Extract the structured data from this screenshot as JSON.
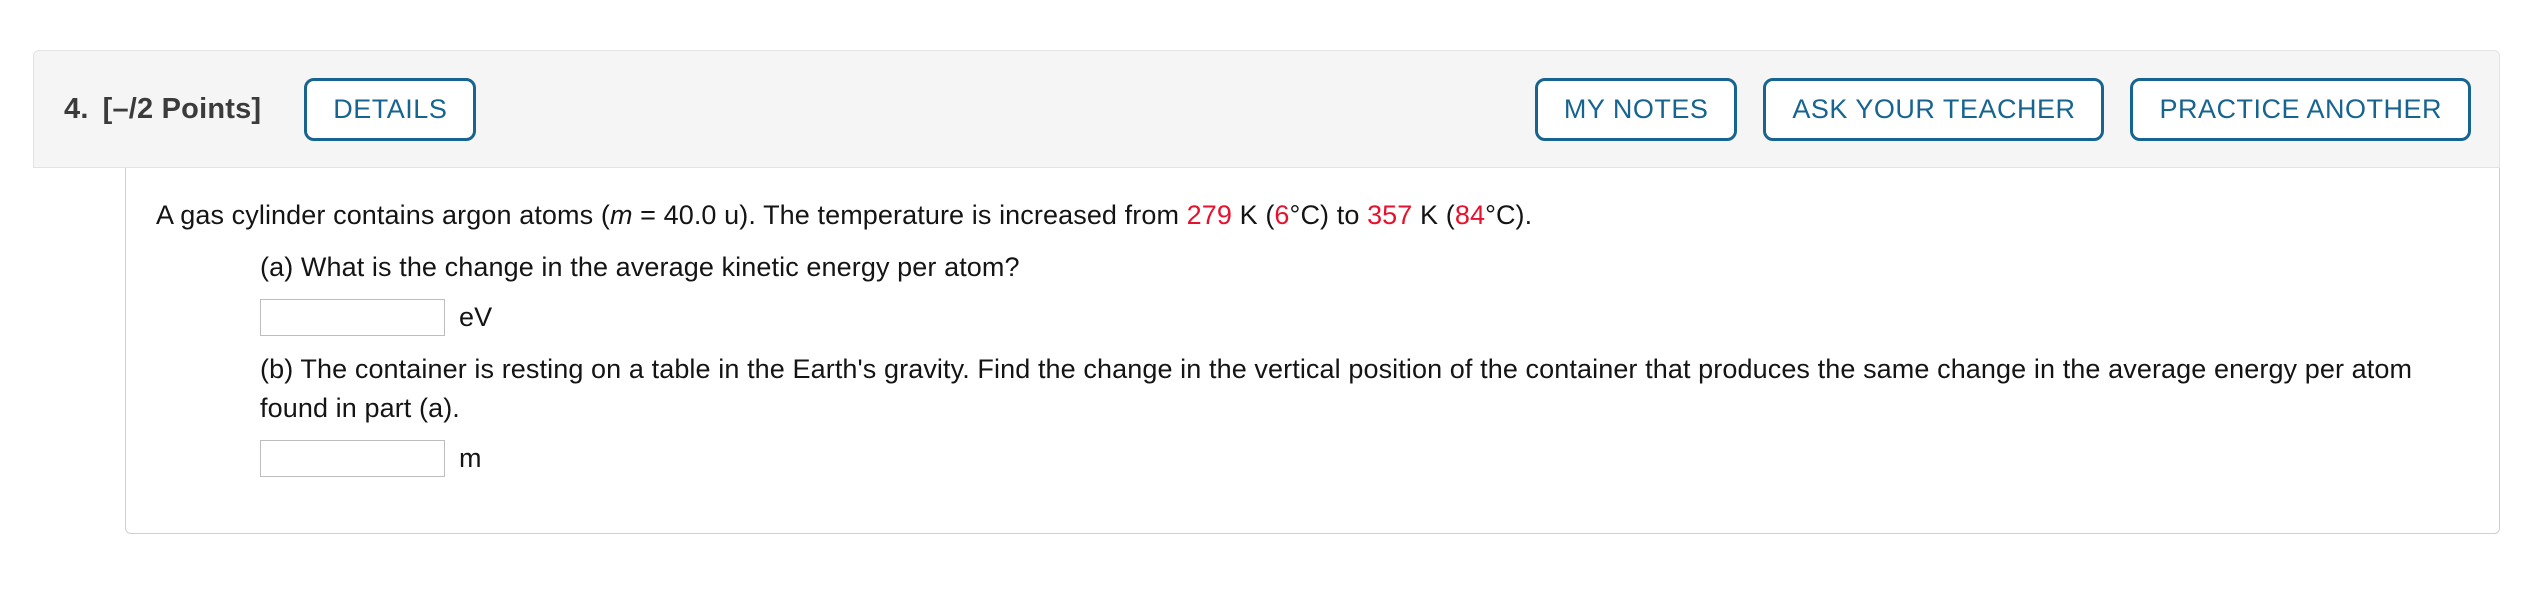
{
  "header": {
    "question_number": "4.",
    "points": "[–/2 Points]",
    "details_label": "DETAILS",
    "right_buttons": [
      {
        "label": "MY NOTES",
        "name": "my-notes-button"
      },
      {
        "label": "ASK YOUR TEACHER",
        "name": "ask-your-teacher-button"
      },
      {
        "label": "PRACTICE ANOTHER",
        "name": "practice-another-button"
      }
    ]
  },
  "question": {
    "stem_part1": "A gas cylinder contains argon atoms  (",
    "stem_var": "m",
    "stem_part2": " = 40.0 u).  The temperature is increased from ",
    "temp_initial_k": "279",
    "stem_part3": " K (",
    "temp_initial_c": "6",
    "stem_part4": "°C) to ",
    "temp_final_k": "357",
    "stem_part5": " K (",
    "temp_final_c": "84",
    "stem_part6": "°C)."
  },
  "parts": {
    "a": {
      "prompt": "(a) What is the change in the average kinetic energy per atom?",
      "input_value": "",
      "input_placeholder": "",
      "unit": "eV"
    },
    "b": {
      "prompt": "(b) The container is resting on a table in the Earth's gravity. Find the change in the vertical position of the container that produces the same change in the average energy per atom found in part (a).",
      "input_value": "",
      "input_placeholder": "",
      "unit": "m"
    }
  },
  "colors": {
    "accent_blue": "#16648f",
    "value_red": "#e8112d",
    "header_bg": "#f5f5f5",
    "border_gray": "#cfcfcf"
  }
}
